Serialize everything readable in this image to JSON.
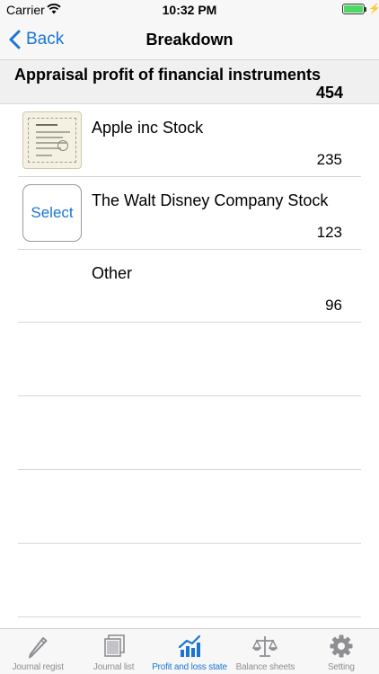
{
  "status_bar": {
    "carrier": "Carrier",
    "time": "10:32 PM",
    "battery_level": 1.0
  },
  "nav": {
    "back_label": "Back",
    "title": "Breakdown"
  },
  "section": {
    "title": "Appraisal profit of financial instruments",
    "total": "454"
  },
  "rows": [
    {
      "thumb": "stock-certificate-image",
      "name": "Apple inc Stock",
      "value": "235"
    },
    {
      "thumb": "select-button",
      "select_label": "Select",
      "name": "The Walt Disney Company Stock",
      "value": "123"
    },
    {
      "thumb": "none",
      "name": "Other",
      "value": "96"
    }
  ],
  "tabs": [
    {
      "label": "Journal regist",
      "icon": "pencil-icon",
      "active": false
    },
    {
      "label": "Journal list",
      "icon": "stacked-pages-icon",
      "active": false
    },
    {
      "label": "Profit and loss state",
      "icon": "bar-chart-icon",
      "active": true
    },
    {
      "label": "Balance sheets",
      "icon": "scale-icon",
      "active": false
    },
    {
      "label": "Setting",
      "icon": "gear-icon",
      "active": false
    }
  ],
  "colors": {
    "accent": "#1976d2",
    "battery_green": "#4cd964",
    "inactive_tab": "#8e8e93"
  }
}
